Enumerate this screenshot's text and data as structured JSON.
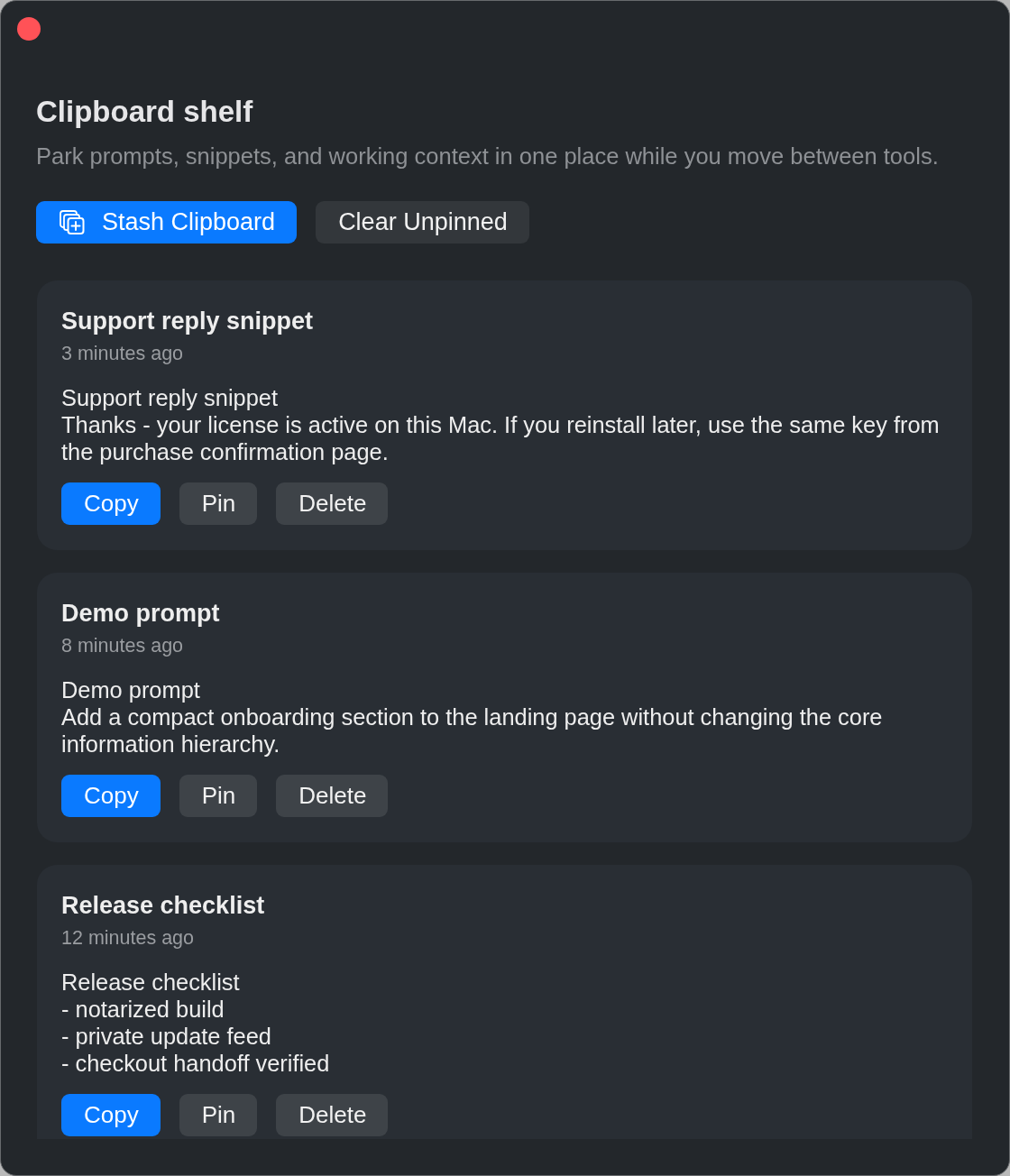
{
  "window": {
    "title": "Clipboard shelf",
    "subtitle": "Park prompts, snippets, and working context in one place while you move between tools."
  },
  "toolbar": {
    "buttons": [
      {
        "label": "Stash Clipboard",
        "kind": "primary",
        "icon": true
      },
      {
        "label": "Clear Unpinned",
        "kind": "secondary",
        "icon": false
      }
    ]
  },
  "clips": [
    {
      "title": "Support reply snippet",
      "time": "3 minutes ago",
      "body": "Support reply snippet\nThanks - your license is active on this Mac. If you reinstall later, use the same key from the purchase confirmation page.",
      "actions": [
        {
          "label": "Copy",
          "kind": "primary"
        },
        {
          "label": "Pin",
          "kind": "secondary"
        },
        {
          "label": "Delete",
          "kind": "secondary"
        }
      ]
    },
    {
      "title": "Demo prompt",
      "time": "8 minutes ago",
      "body": "Demo prompt\nAdd a compact onboarding section to the landing page without changing the core information hierarchy.",
      "actions": [
        {
          "label": "Copy",
          "kind": "primary"
        },
        {
          "label": "Pin",
          "kind": "secondary"
        },
        {
          "label": "Delete",
          "kind": "secondary"
        }
      ]
    },
    {
      "title": "Release checklist",
      "time": "12 minutes ago",
      "body": "Release checklist\n- notarized build\n- private update feed\n- checkout handoff verified",
      "actions": [
        {
          "label": "Copy",
          "kind": "primary"
        },
        {
          "label": "Pin",
          "kind": "secondary"
        },
        {
          "label": "Delete",
          "kind": "secondary"
        }
      ]
    }
  ]
}
